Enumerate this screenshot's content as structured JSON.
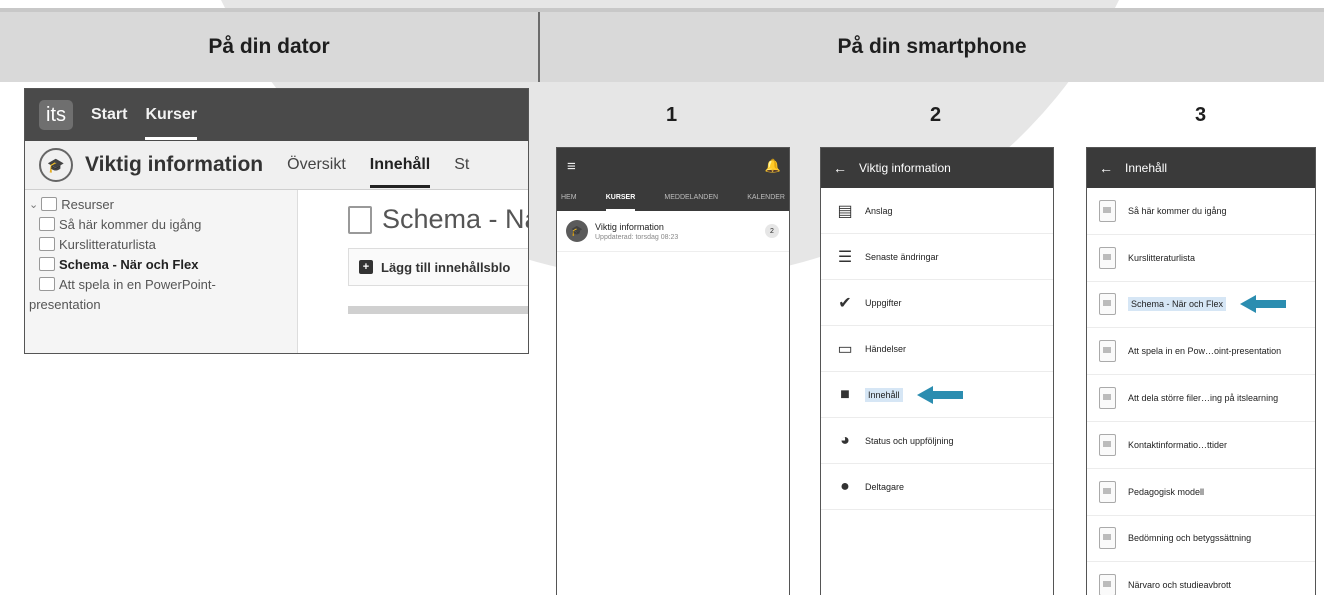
{
  "headers": {
    "left": "På din dator",
    "right": "På din smartphone"
  },
  "steps": [
    "1",
    "2",
    "3"
  ],
  "desktop": {
    "logo": "its",
    "nav": [
      "Start",
      "Kurser"
    ],
    "course_title": "Viktig information",
    "tabs": [
      "Översikt",
      "Innehåll",
      "St"
    ],
    "tree": {
      "folder": "Resurser",
      "items": [
        "Så här kommer du igång",
        "Kurslitteraturlista",
        "Schema - När och Flex",
        "Att spela in en PowerPoint-",
        "presentation"
      ]
    },
    "page_title": "Schema - Nä",
    "add_button": "Lägg till innehållsblo"
  },
  "phone1": {
    "tabs": [
      "HEM",
      "KURSER",
      "MEDDELANDEN",
      "KALENDER"
    ],
    "item_title": "Viktig information",
    "item_sub": "Uppdaterad: torsdag 08:23",
    "badge": "2"
  },
  "phone2": {
    "title": "Viktig information",
    "items": [
      "Anslag",
      "Senaste ändringar",
      "Uppgifter",
      "Händelser",
      "Innehåll",
      "Status och uppföljning",
      "Deltagare"
    ],
    "highlighted": "Innehåll"
  },
  "phone3": {
    "title": "Innehåll",
    "items": [
      "Så här kommer du igång",
      "Kurslitteraturlista",
      "Schema - När och Flex",
      "Att spela in en Pow…oint-presentation",
      "Att dela större filer…ing på itslearning",
      "Kontaktinformatio…ttider",
      "Pedagogisk modell",
      "Bedömning och betygssättning",
      "Närvaro och studieavbrott"
    ],
    "highlighted": "Schema - När och Flex"
  },
  "colors": {
    "accent": "#2b8db0",
    "topbar": "#3a3a3a",
    "highlight": "#d6e6f5"
  }
}
